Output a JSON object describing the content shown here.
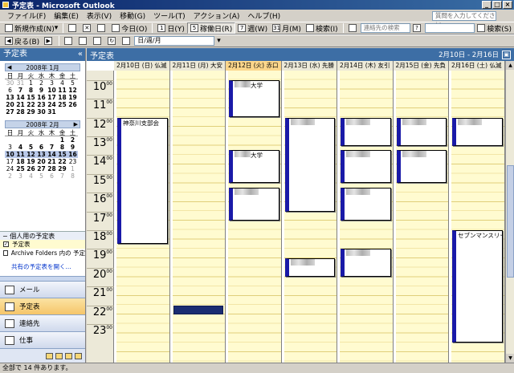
{
  "window": {
    "title": "予定表 - Microsoft Outlook"
  },
  "menu": [
    "ファイル(F)",
    "編集(E)",
    "表示(V)",
    "移動(G)",
    "ツール(T)",
    "アクション(A)",
    "ヘルプ(H)"
  ],
  "help_placeholder": "質問を入力してください",
  "toolbar1": {
    "new_label": "新規作成(N)",
    "today_label": "今日(O)",
    "day_label": "日(Y)",
    "workweek_label": "稼働日(R)",
    "week_label": "週(W)",
    "month_label": "月(M)",
    "find_label": "検索(I)",
    "contact_search_placeholder": "連絡先の検索",
    "search_label": "検索(S)"
  },
  "toolbar2": {
    "back_label": "戻る(B)",
    "address_value": "日/週/月"
  },
  "navpane": {
    "title": "予定表",
    "months": [
      {
        "title": "2008年 1月",
        "dow": [
          "日",
          "月",
          "火",
          "水",
          "木",
          "金",
          "土"
        ],
        "days": [
          {
            "d": "30",
            "c": "out"
          },
          {
            "d": "31",
            "c": "out"
          },
          {
            "d": "1",
            "c": ""
          },
          {
            "d": "2",
            "c": ""
          },
          {
            "d": "3",
            "c": ""
          },
          {
            "d": "4",
            "c": ""
          },
          {
            "d": "5",
            "c": ""
          },
          {
            "d": "6",
            "c": ""
          },
          {
            "d": "7",
            "c": "bold"
          },
          {
            "d": "8",
            "c": "bold"
          },
          {
            "d": "9",
            "c": "bold"
          },
          {
            "d": "10",
            "c": "bold"
          },
          {
            "d": "11",
            "c": "bold"
          },
          {
            "d": "12",
            "c": "bold"
          },
          {
            "d": "13",
            "c": "bold"
          },
          {
            "d": "14",
            "c": "bold"
          },
          {
            "d": "15",
            "c": "bold"
          },
          {
            "d": "16",
            "c": "bold"
          },
          {
            "d": "17",
            "c": "bold"
          },
          {
            "d": "18",
            "c": "bold"
          },
          {
            "d": "19",
            "c": "bold"
          },
          {
            "d": "20",
            "c": "bold"
          },
          {
            "d": "21",
            "c": "bold"
          },
          {
            "d": "22",
            "c": "bold"
          },
          {
            "d": "23",
            "c": "bold"
          },
          {
            "d": "24",
            "c": "bold"
          },
          {
            "d": "25",
            "c": "bold"
          },
          {
            "d": "26",
            "c": "bold"
          },
          {
            "d": "27",
            "c": "bold"
          },
          {
            "d": "28",
            "c": "bold"
          },
          {
            "d": "29",
            "c": "bold"
          },
          {
            "d": "30",
            "c": "bold"
          },
          {
            "d": "31",
            "c": "bold"
          },
          {
            "d": "",
            "c": ""
          },
          {
            "d": "",
            "c": ""
          }
        ]
      },
      {
        "title": "2008年 2月",
        "dow": [
          "日",
          "月",
          "火",
          "水",
          "木",
          "金",
          "土"
        ],
        "days": [
          {
            "d": "",
            "c": ""
          },
          {
            "d": "",
            "c": ""
          },
          {
            "d": "",
            "c": ""
          },
          {
            "d": "",
            "c": ""
          },
          {
            "d": "",
            "c": ""
          },
          {
            "d": "1",
            "c": "bold"
          },
          {
            "d": "2",
            "c": "bold"
          },
          {
            "d": "3",
            "c": ""
          },
          {
            "d": "4",
            "c": "bold"
          },
          {
            "d": "5",
            "c": "bold"
          },
          {
            "d": "6",
            "c": "bold"
          },
          {
            "d": "7",
            "c": "bold"
          },
          {
            "d": "8",
            "c": "bold"
          },
          {
            "d": "9",
            "c": "bold"
          },
          {
            "d": "10",
            "c": "bold sel"
          },
          {
            "d": "11",
            "c": "bold sel"
          },
          {
            "d": "12",
            "c": "bold sel"
          },
          {
            "d": "13",
            "c": "bold sel"
          },
          {
            "d": "14",
            "c": "bold sel"
          },
          {
            "d": "15",
            "c": "bold sel"
          },
          {
            "d": "16",
            "c": "bold sel"
          },
          {
            "d": "17",
            "c": ""
          },
          {
            "d": "18",
            "c": "bold"
          },
          {
            "d": "19",
            "c": "bold"
          },
          {
            "d": "20",
            "c": "bold"
          },
          {
            "d": "21",
            "c": "bold"
          },
          {
            "d": "22",
            "c": "bold"
          },
          {
            "d": "23",
            "c": ""
          },
          {
            "d": "24",
            "c": ""
          },
          {
            "d": "25",
            "c": "bold"
          },
          {
            "d": "26",
            "c": "bold"
          },
          {
            "d": "27",
            "c": "bold"
          },
          {
            "d": "28",
            "c": "bold"
          },
          {
            "d": "29",
            "c": "bold"
          },
          {
            "d": "1",
            "c": "out"
          },
          {
            "d": "2",
            "c": "out"
          },
          {
            "d": "3",
            "c": "out"
          },
          {
            "d": "4",
            "c": "out"
          },
          {
            "d": "5",
            "c": "out"
          },
          {
            "d": "6",
            "c": "out"
          },
          {
            "d": "7",
            "c": "out"
          },
          {
            "d": "8",
            "c": "out"
          }
        ]
      }
    ],
    "my_calendars_header": "個人用の予定表",
    "my_calendars": [
      {
        "label": "予定表",
        "checked": true
      },
      {
        "label": "Archive Folders 内の 予定",
        "checked": false
      }
    ],
    "shared_link": "共有の予定表を開く...",
    "nav_buttons": [
      {
        "label": "メール",
        "selected": false,
        "icon": "mail-icon"
      },
      {
        "label": "予定表",
        "selected": true,
        "icon": "calendar-icon"
      },
      {
        "label": "連絡先",
        "selected": false,
        "icon": "contacts-icon"
      },
      {
        "label": "仕事",
        "selected": false,
        "icon": "tasks-icon"
      }
    ]
  },
  "calendar": {
    "title": "予定表",
    "date_range": "2月10日 - 2月16日",
    "days": [
      {
        "label": "2月10日 (日) 仏滅",
        "today": false
      },
      {
        "label": "2月11日 (月) 大安",
        "today": false
      },
      {
        "label": "2月12日 (火) 赤口",
        "today": true
      },
      {
        "label": "2月13日 (水) 先勝",
        "today": false
      },
      {
        "label": "2月14日 (木) 友引",
        "today": false
      },
      {
        "label": "2月15日 (金) 先負",
        "today": false
      },
      {
        "label": "2月16日 (土) 仏滅",
        "today": false
      }
    ],
    "hours": [
      {
        "h": "10",
        "m": "00"
      },
      {
        "h": "11",
        "m": "00"
      },
      {
        "h": "12",
        "m": "00"
      },
      {
        "h": "13",
        "m": "00"
      },
      {
        "h": "14",
        "m": "00"
      },
      {
        "h": "15",
        "m": "00"
      },
      {
        "h": "16",
        "m": "00"
      },
      {
        "h": "17",
        "m": "00"
      },
      {
        "h": "18",
        "m": "00"
      },
      {
        "h": "19",
        "m": "00"
      },
      {
        "h": "20",
        "m": "00"
      },
      {
        "h": "21",
        "m": "00"
      },
      {
        "h": "22",
        "m": "00"
      },
      {
        "h": "23",
        "m": "00"
      }
    ],
    "first_visible_hour": 9.5,
    "events": [
      {
        "day": 0,
        "start": 12.0,
        "end": 18.75,
        "text": "神奈川支部会",
        "blur": false,
        "bar": false
      },
      {
        "day": 1,
        "start": 22.0,
        "end": 22.5,
        "text": "",
        "blur": false,
        "bar": true
      },
      {
        "day": 2,
        "start": 10.0,
        "end": 12.0,
        "text": "大学",
        "blur": true,
        "bar": false
      },
      {
        "day": 2,
        "start": 13.75,
        "end": 15.5,
        "text": "大学",
        "blur": true,
        "bar": false
      },
      {
        "day": 2,
        "start": 15.75,
        "end": 17.5,
        "text": "",
        "blur": true,
        "bar": false
      },
      {
        "day": 3,
        "start": 12.0,
        "end": 17.0,
        "text": "",
        "blur": true,
        "bar": false
      },
      {
        "day": 3,
        "start": 19.5,
        "end": 20.5,
        "text": "",
        "blur": true,
        "bar": false
      },
      {
        "day": 4,
        "start": 12.0,
        "end": 13.5,
        "text": "",
        "blur": true,
        "bar": false
      },
      {
        "day": 4,
        "start": 13.75,
        "end": 15.5,
        "text": "",
        "blur": true,
        "bar": false
      },
      {
        "day": 4,
        "start": 15.75,
        "end": 17.5,
        "text": "",
        "blur": true,
        "bar": false
      },
      {
        "day": 4,
        "start": 19.0,
        "end": 20.5,
        "text": "",
        "blur": true,
        "bar": false
      },
      {
        "day": 5,
        "start": 12.0,
        "end": 13.5,
        "text": "",
        "blur": true,
        "bar": false
      },
      {
        "day": 5,
        "start": 13.75,
        "end": 15.5,
        "text": "",
        "blur": true,
        "bar": false
      },
      {
        "day": 6,
        "start": 12.0,
        "end": 13.5,
        "text": "",
        "blur": true,
        "bar": false
      },
      {
        "day": 6,
        "start": 18.0,
        "end": 24.0,
        "text": "セブンマンスリー",
        "blur": false,
        "bar": false
      }
    ]
  },
  "status": "全部で 14 件あります。"
}
